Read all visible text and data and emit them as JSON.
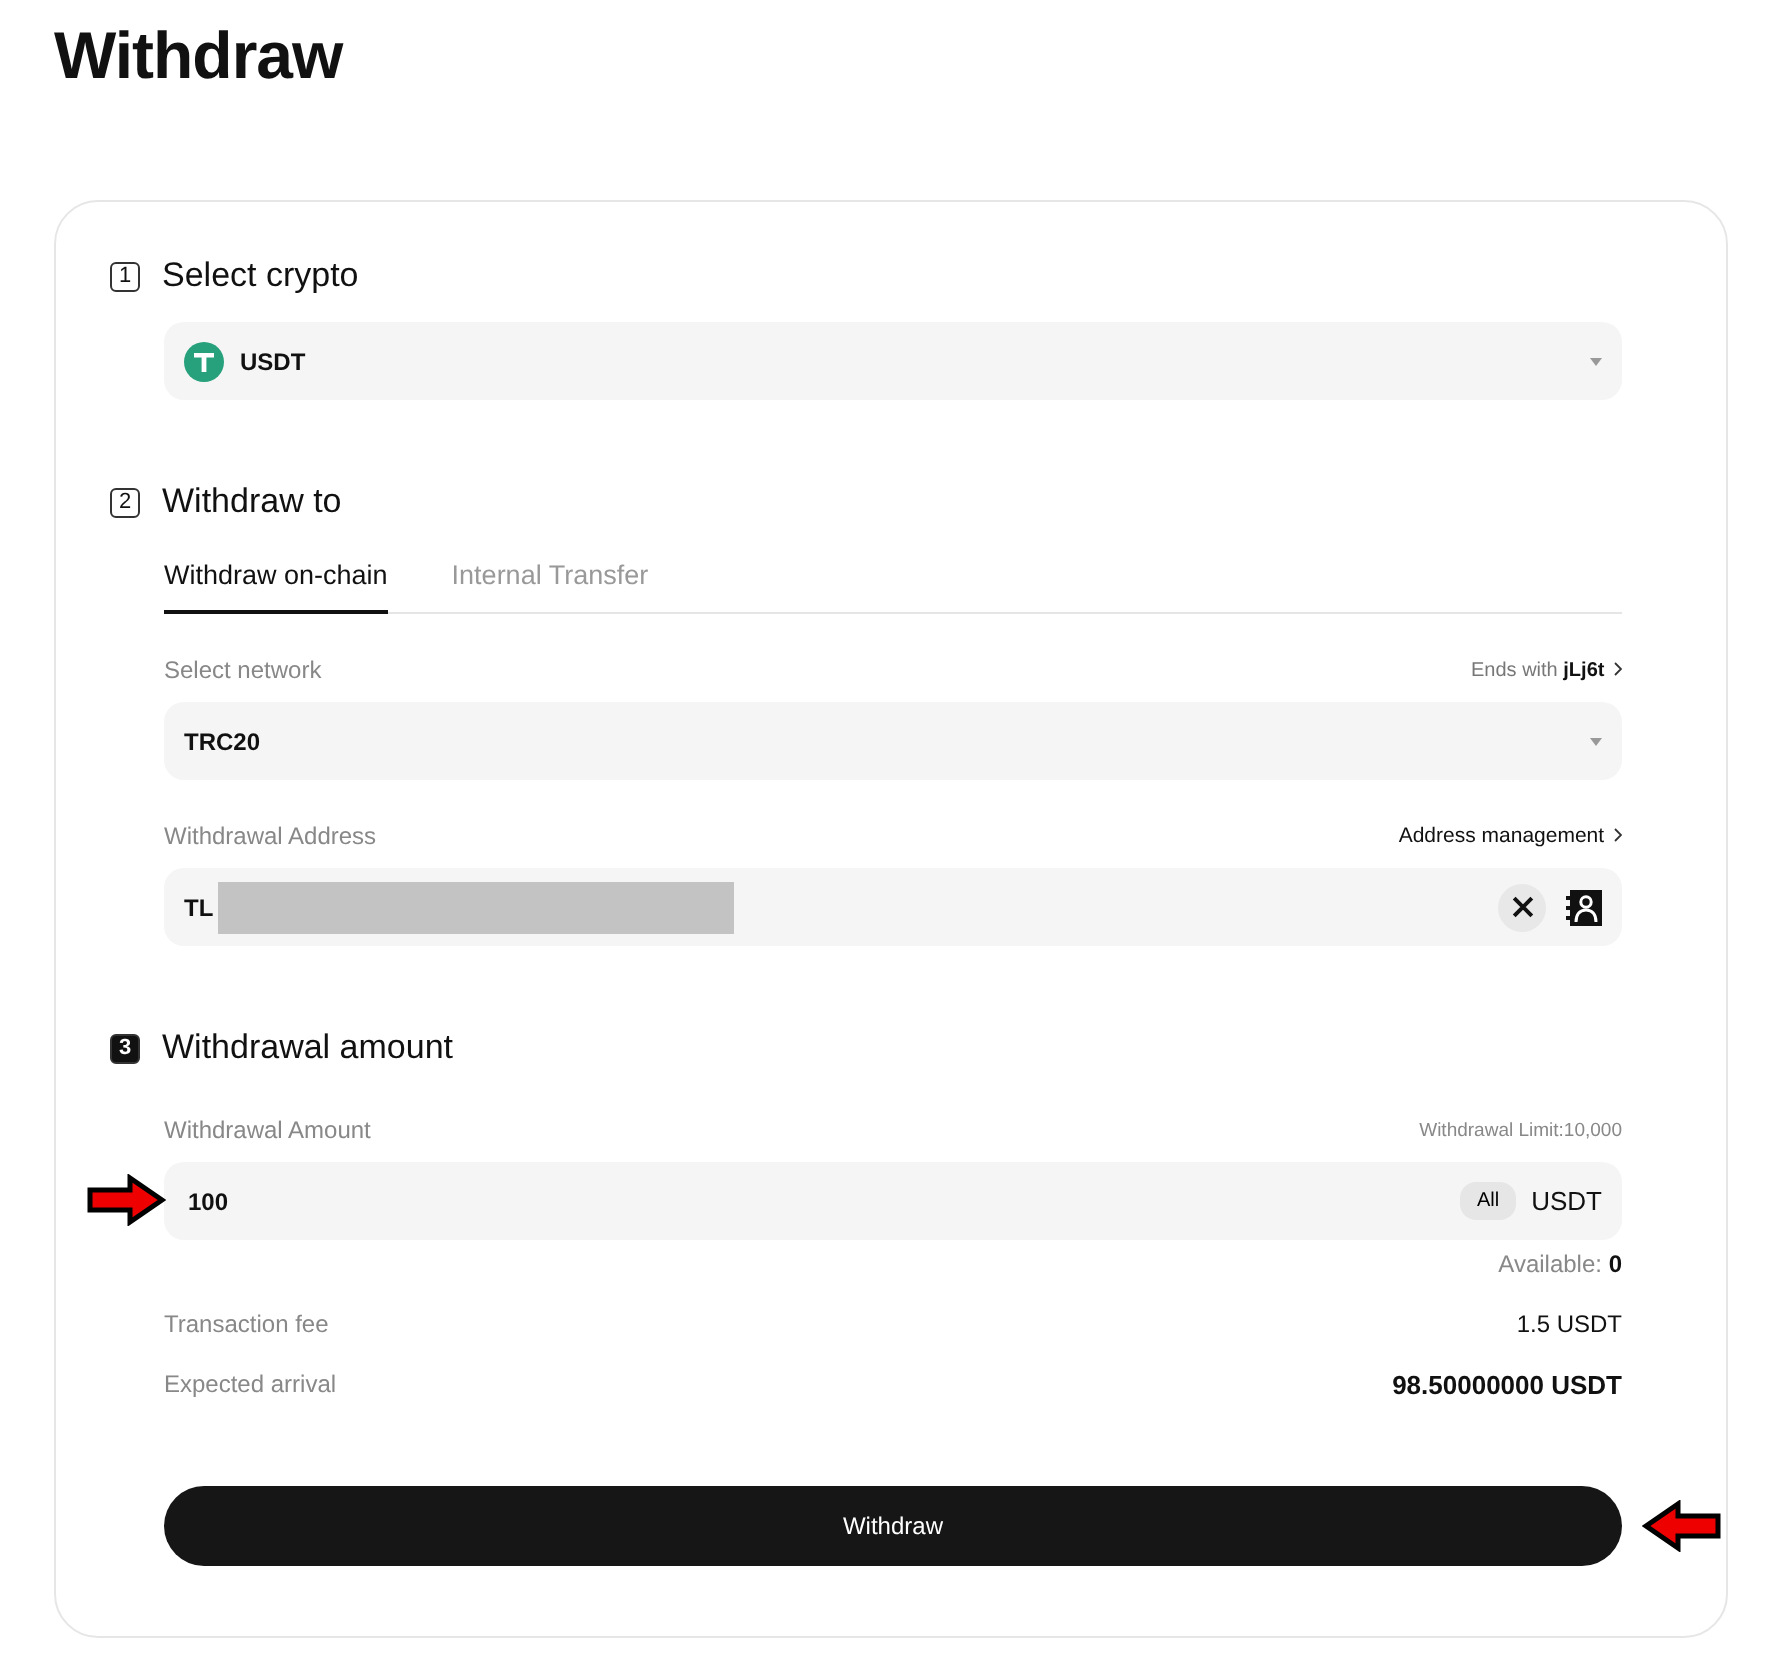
{
  "title": "Withdraw",
  "select_crypto": {
    "step": "1",
    "step_filled": false,
    "heading": "Select crypto",
    "value": "USDT"
  },
  "withdraw_to": {
    "step": "2",
    "step_filled": false,
    "heading": "Withdraw to",
    "tabs": [
      {
        "label": "Withdraw on-chain",
        "selected": true
      },
      {
        "label": "Internal Transfer",
        "selected": false
      }
    ],
    "network": {
      "label": "Select network",
      "hint_prefix": "Ends with",
      "hint_value": "jLj6t",
      "value": "TRC20"
    },
    "address": {
      "label": "Withdrawal Address",
      "link": "Address management",
      "value": "TL"
    }
  },
  "amount": {
    "step": "3",
    "step_filled": true,
    "heading": "Withdrawal amount",
    "label": "Withdrawal Amount",
    "limit": "Withdrawal Limit:10,000",
    "value": "100",
    "all_button": "All",
    "unit": "USDT",
    "available_label": "Available:",
    "available_value": "0",
    "rows": [
      {
        "label": "Transaction fee",
        "value": "1.5 USDT",
        "bold": false
      },
      {
        "label": "Expected arrival",
        "value": "98.50000000 USDT",
        "bold": true
      }
    ]
  },
  "submit": "Withdraw"
}
